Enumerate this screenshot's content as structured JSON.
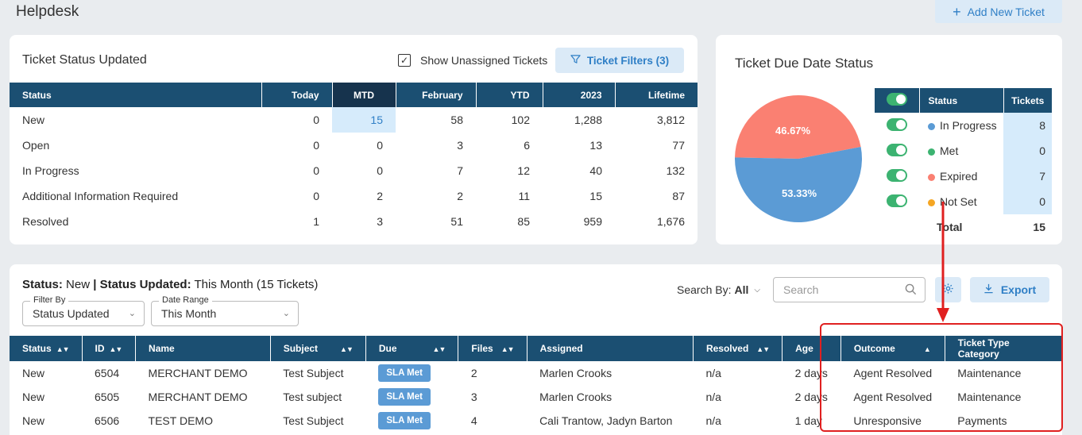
{
  "header": {
    "title": "Helpdesk",
    "add_ticket": "Add New Ticket"
  },
  "status_card": {
    "title": "Ticket Status Updated",
    "show_unassigned_label": "Show Unassigned Tickets",
    "show_unassigned_checked": true,
    "filters_label": "Ticket Filters (3)",
    "columns": [
      "Status",
      "Today",
      "MTD",
      "February",
      "YTD",
      "2023",
      "Lifetime"
    ],
    "rows": [
      [
        "New",
        "0",
        "15",
        "58",
        "102",
        "1,288",
        "3,812"
      ],
      [
        "Open",
        "0",
        "0",
        "3",
        "6",
        "13",
        "77"
      ],
      [
        "In Progress",
        "0",
        "0",
        "7",
        "12",
        "40",
        "132"
      ],
      [
        "Additional Information Required",
        "0",
        "2",
        "2",
        "11",
        "15",
        "87"
      ],
      [
        "Resolved",
        "1",
        "3",
        "51",
        "85",
        "959",
        "1,676"
      ]
    ]
  },
  "due_card": {
    "title": "Ticket Due Date Status",
    "pie": [
      {
        "label": "In Progress",
        "percent": "53.33%",
        "value": 53.33,
        "color": "#5b9bd5"
      },
      {
        "label": "Expired",
        "percent": "46.67%",
        "value": 46.67,
        "color": "#fa8072"
      }
    ],
    "columns": [
      "Status",
      "Tickets"
    ],
    "rows": [
      {
        "status": "In Progress",
        "tickets": "8",
        "color": "#5b9bd5"
      },
      {
        "status": "Met",
        "tickets": "0",
        "color": "#3cb371"
      },
      {
        "status": "Expired",
        "tickets": "7",
        "color": "#fa8072"
      },
      {
        "status": "Not Set",
        "tickets": "0",
        "color": "#f5a623"
      }
    ],
    "total_label": "Total",
    "total_value": "15"
  },
  "list_card": {
    "status_key": "Status:",
    "status_val": "New",
    "sep": "|",
    "updated_key": "Status Updated:",
    "updated_val": "This Month (15 Tickets)",
    "search_by_label": "Search By:",
    "search_by_value": "All",
    "search_placeholder": "Search",
    "export_label": "Export",
    "filter_by": {
      "label": "Filter By",
      "value": "Status Updated"
    },
    "date_range": {
      "label": "Date Range",
      "value": "This Month"
    },
    "columns": [
      "Status",
      "ID",
      "Name",
      "Subject",
      "Due",
      "Files",
      "Assigned",
      "Resolved",
      "Age",
      "Outcome",
      "Ticket Type Category"
    ],
    "rows": [
      [
        "New",
        "6504",
        "MERCHANT DEMO",
        "Test Subject",
        "SLA Met",
        "2",
        "Marlen Crooks",
        "n/a",
        "2 days",
        "Agent Resolved",
        "Maintenance"
      ],
      [
        "New",
        "6505",
        "MERCHANT DEMO",
        "Test subject",
        "SLA Met",
        "3",
        "Marlen Crooks",
        "n/a",
        "2 days",
        "Agent Resolved",
        "Maintenance"
      ],
      [
        "New",
        "6506",
        "TEST DEMO",
        "Test Subject",
        "SLA Met",
        "4",
        "Cali Trantow,  Jadyn Barton",
        "n/a",
        "1 day",
        "Unresponsive",
        "Payments"
      ]
    ]
  }
}
